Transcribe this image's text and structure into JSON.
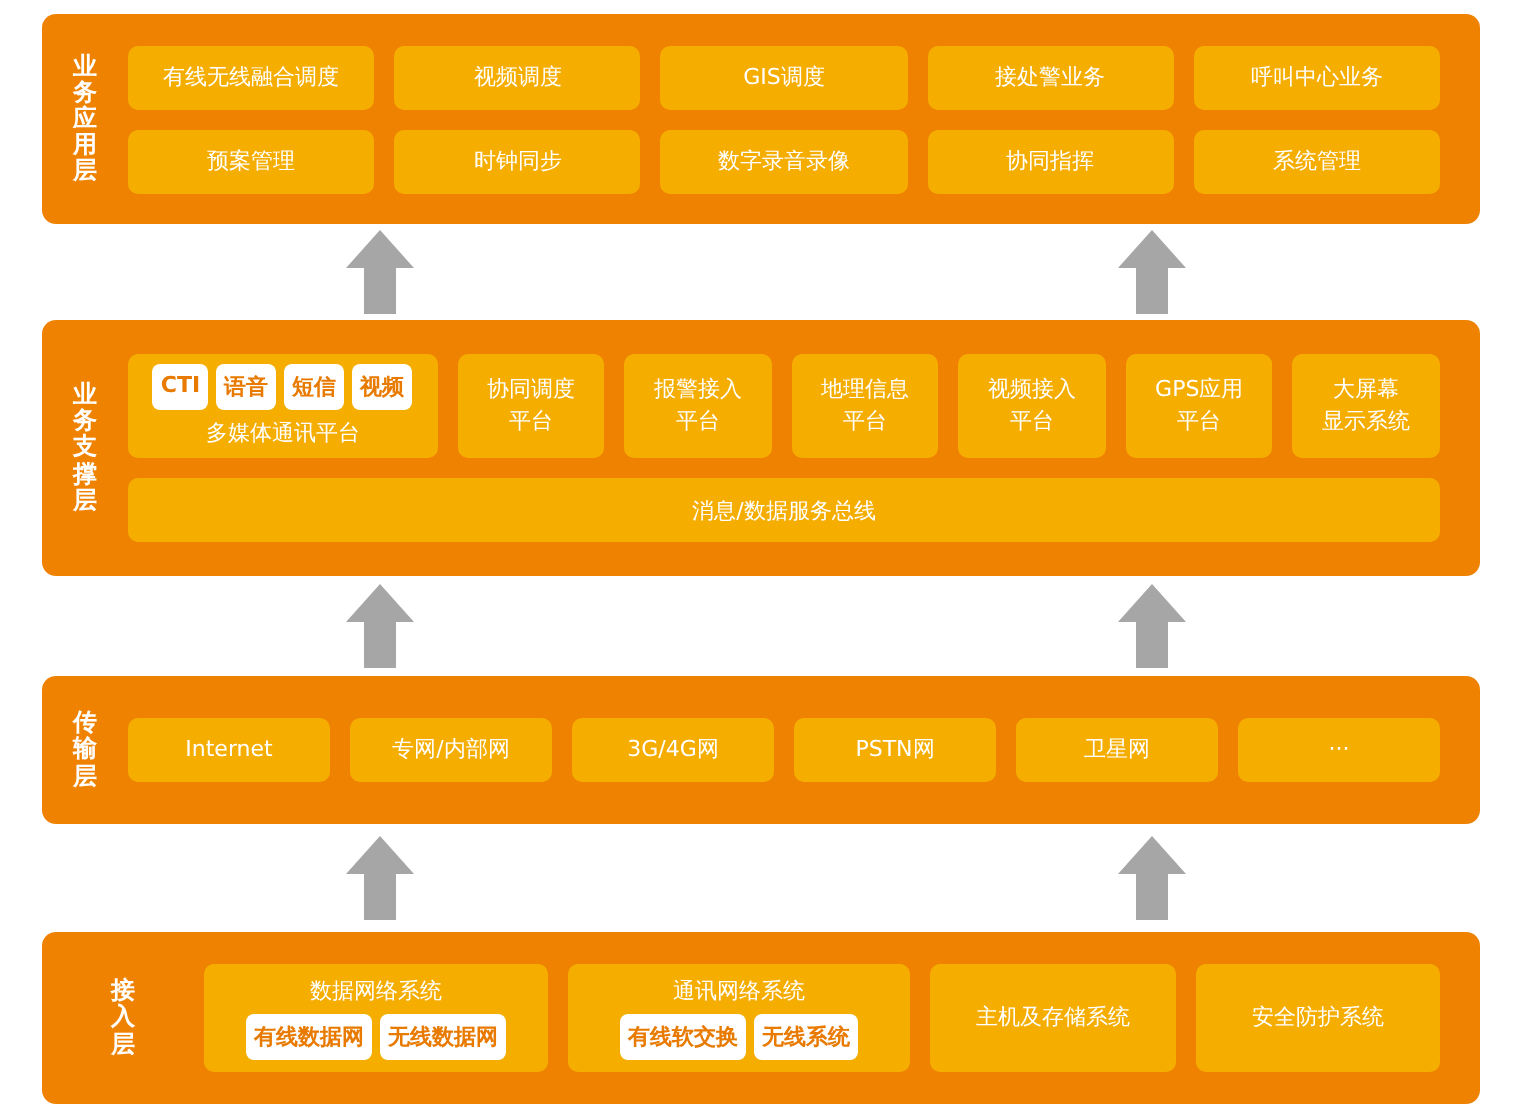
{
  "layers": [
    {
      "label": "业务应用层",
      "kind": "grid",
      "rows": [
        [
          {
            "kind": "box",
            "lines": [
              "有线无线融合调度"
            ]
          },
          {
            "kind": "box",
            "lines": [
              "视频调度"
            ]
          },
          {
            "kind": "box",
            "lines": [
              "GIS调度"
            ]
          },
          {
            "kind": "box",
            "lines": [
              "接处警业务"
            ]
          },
          {
            "kind": "box",
            "lines": [
              "呼叫中心业务"
            ]
          }
        ],
        [
          {
            "kind": "box",
            "lines": [
              "预案管理"
            ]
          },
          {
            "kind": "box",
            "lines": [
              "时钟同步"
            ]
          },
          {
            "kind": "box",
            "lines": [
              "数字录音录像"
            ]
          },
          {
            "kind": "box",
            "lines": [
              "协同指挥"
            ]
          },
          {
            "kind": "box",
            "lines": [
              "系统管理"
            ]
          }
        ]
      ]
    },
    {
      "label": "业务支撑层",
      "kind": "support",
      "rows": [
        [
          {
            "kind": "group_label_below",
            "text": "多媒体通讯平台",
            "chips": [
              "CTI",
              "语音",
              "短信",
              "视频"
            ]
          },
          {
            "kind": "box",
            "lines": [
              "协同调度",
              "平台"
            ]
          },
          {
            "kind": "box",
            "lines": [
              "报警接入",
              "平台"
            ]
          },
          {
            "kind": "box",
            "lines": [
              "地理信息",
              "平台"
            ]
          },
          {
            "kind": "box",
            "lines": [
              "视频接入",
              "平台"
            ]
          },
          {
            "kind": "box",
            "lines": [
              "GPS应用",
              "平台"
            ]
          },
          {
            "kind": "box",
            "lines": [
              "大屏幕",
              "显示系统"
            ]
          }
        ]
      ],
      "bus": "消息/数据服务总线"
    },
    {
      "label": "传输层",
      "kind": "grid",
      "rows": [
        [
          {
            "kind": "box",
            "lines": [
              "Internet"
            ]
          },
          {
            "kind": "box",
            "lines": [
              "专网/内部网"
            ]
          },
          {
            "kind": "box",
            "lines": [
              "3G/4G网"
            ]
          },
          {
            "kind": "box",
            "lines": [
              "PSTN网"
            ]
          },
          {
            "kind": "box",
            "lines": [
              "卫星网"
            ]
          },
          {
            "kind": "box",
            "lines": [
              "···"
            ]
          }
        ]
      ]
    },
    {
      "label": "接入层",
      "kind": "access",
      "rows": [
        [
          {
            "kind": "group_label_above",
            "text": "数据网络系统",
            "chips": [
              "有线数据网",
              "无线数据网"
            ]
          },
          {
            "kind": "group_label_above",
            "text": "通讯网络系统",
            "chips": [
              "有线软交换",
              "无线系统"
            ]
          },
          {
            "kind": "box",
            "lines": [
              "主机及存储系统"
            ]
          },
          {
            "kind": "box",
            "lines": [
              "安全防护系统"
            ]
          }
        ]
      ]
    }
  ]
}
